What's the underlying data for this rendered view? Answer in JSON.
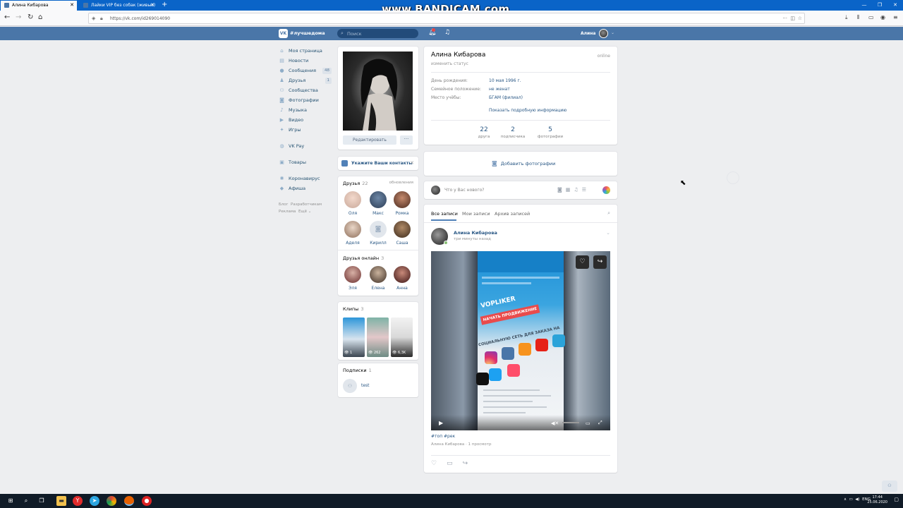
{
  "browser": {
    "tabs": [
      {
        "title": "Алина Кибарова",
        "active": true
      },
      {
        "title": "Лайки VIP без собак (живые)",
        "active": false
      }
    ],
    "url": "https://vk.com/id269014090",
    "watermark": "www.BANDICAM.com"
  },
  "vk": {
    "header": {
      "hashtag": "#лучшедома",
      "search_placeholder": "Поиск",
      "user_name": "Алина"
    },
    "sidebar": {
      "items": [
        {
          "label": "Моя страница",
          "icon": "home-icon"
        },
        {
          "label": "Новости",
          "icon": "news-icon"
        },
        {
          "label": "Сообщения",
          "icon": "messages-icon",
          "count": "48"
        },
        {
          "label": "Друзья",
          "icon": "friends-icon",
          "count": "1"
        },
        {
          "label": "Сообщества",
          "icon": "communities-icon"
        },
        {
          "label": "Фотографии",
          "icon": "photos-icon"
        },
        {
          "label": "Музыка",
          "icon": "music-icon"
        },
        {
          "label": "Видео",
          "icon": "video-icon"
        },
        {
          "label": "Игры",
          "icon": "games-icon"
        }
      ],
      "extra": [
        {
          "label": "VK Pay",
          "icon": "vkpay-icon"
        },
        {
          "label": "Товары",
          "icon": "goods-icon"
        },
        {
          "label": "Коронавирус",
          "icon": "virus-icon"
        },
        {
          "label": "Афиша",
          "icon": "afisha-icon"
        }
      ],
      "footer": {
        "blog": "Блог",
        "dev": "Разработчикам",
        "ads": "Реклама",
        "more": "Ещё"
      }
    },
    "profile": {
      "edit_label": "Редактировать",
      "more_label": "···",
      "contacts_prompt": "Укажите Ваши контакты",
      "name": "Алина Кибарова",
      "status": "изменить статус",
      "online": "online",
      "info": [
        {
          "label": "День рождения:",
          "value": "10 мая 1996 г."
        },
        {
          "label": "Семейное положение:",
          "value": "не женат"
        },
        {
          "label": "Место учёбы:",
          "value": "БГАМ (филиал)"
        }
      ],
      "show_more": "Показать подробную информацию",
      "stats": [
        {
          "num": "22",
          "label": "друга"
        },
        {
          "num": "2",
          "label": "подписчика"
        },
        {
          "num": "5",
          "label": "фотографии"
        }
      ],
      "add_photos": "Добавить фотографии"
    },
    "friends": {
      "title": "Друзья",
      "count": "22",
      "updates": "обновления",
      "list": [
        "Оля",
        "Макс",
        "Ромка",
        "Аделя",
        "Кирилл",
        "Саша"
      ],
      "online_title": "Друзья онлайн",
      "online_count": "3",
      "online_list": [
        "Эля",
        "Елена",
        "Анна"
      ]
    },
    "clips": {
      "title": "Клипы",
      "count": "3",
      "views": [
        "1",
        "262",
        "6,3K"
      ]
    },
    "subs": {
      "title": "Подписки",
      "count": "1",
      "name": "test"
    },
    "compose": {
      "placeholder": "Что у Вас нового?"
    },
    "wall": {
      "tabs": [
        "Все записи",
        "Мои записи",
        "Архив записей"
      ],
      "post": {
        "author": "Алина Кибарова",
        "time": "три минуты назад",
        "tags": "#топ #рек",
        "meta": "Алина Кибарова · 1 просмотр",
        "video_text": {
          "logo": "VOPLIKER",
          "button": "НАЧАТЬ ПРОДВИЖЕНИЕ",
          "banner": "СОЦИАЛЬНУЮ СЕТЬ ДЛЯ ЗАКАЗА НА"
        }
      }
    }
  },
  "taskbar": {
    "lang": "ENG",
    "time": "17:44",
    "date": "25.06.2020"
  },
  "colors": {
    "vk_blue": "#4a76a8",
    "link": "#2a5885",
    "background": "#edeef0",
    "tabbar": "#0a64c8"
  }
}
